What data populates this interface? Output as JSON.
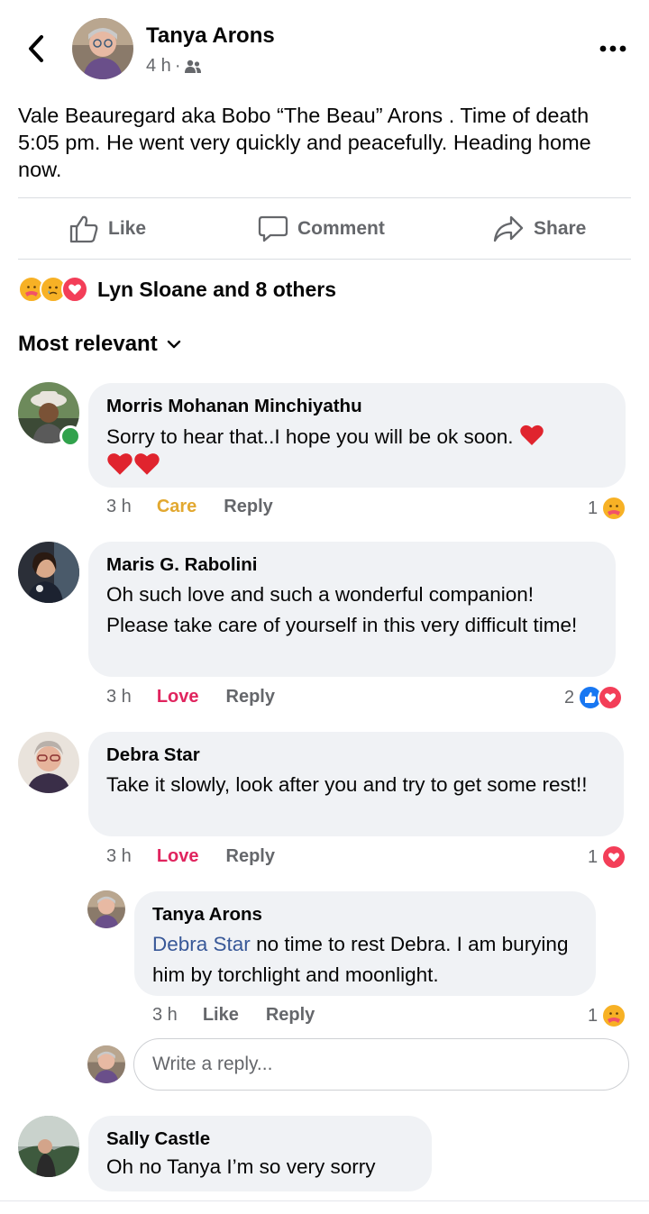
{
  "post": {
    "author": "Tanya Arons",
    "time": "4 h",
    "audience_icon": "friends-icon",
    "text": "Vale Beauregard aka Bobo “The Beau” Arons .  Time of death 5:05 pm.  He went very quickly and peacefully. Heading home now."
  },
  "actions": {
    "like": "Like",
    "comment": "Comment",
    "share": "Share"
  },
  "reactions": {
    "icons": [
      "care-icon",
      "sad-icon",
      "love-icon"
    ],
    "summary": "Lyn Sloane and 8 others"
  },
  "sort": {
    "label": "Most relevant"
  },
  "comments": [
    {
      "name": "Morris Mohanan Minchiyathu",
      "text_line1": "Sorry to hear that..I hope you will be ok soon.",
      "time": "3 h",
      "my_reaction": "Care",
      "reply": "Reply",
      "reaction_count": "1",
      "online": true
    },
    {
      "name": "Maris G. Rabolini",
      "text": "Oh such love and such a wonderful companion! Please take care of yourself in this very difficult time!",
      "time": "3 h",
      "my_reaction": "Love",
      "reply": "Reply",
      "reaction_count": "2"
    },
    {
      "name": "Debra Star",
      "text": "Take it slowly, look after you and try to get some rest!!",
      "time": "3 h",
      "my_reaction": "Love",
      "reply": "Reply",
      "reaction_count": "1",
      "replies": [
        {
          "name": "Tanya Arons",
          "mention": "Debra Star",
          "text": " no time to rest Debra.  I am burying  him by torchlight and moonlight.",
          "time": "3 h",
          "like": "Like",
          "reply": "Reply",
          "reaction_count": "1"
        }
      ],
      "reply_input_placeholder": "Write a reply..."
    },
    {
      "name": "Sally Castle",
      "text": "Oh no Tanya I’m so very sorry"
    }
  ],
  "colors": {
    "care": "#e2a830",
    "love": "#e0245e",
    "link": "#385898",
    "secondary": "#65676b",
    "bubble": "#f0f2f5"
  }
}
